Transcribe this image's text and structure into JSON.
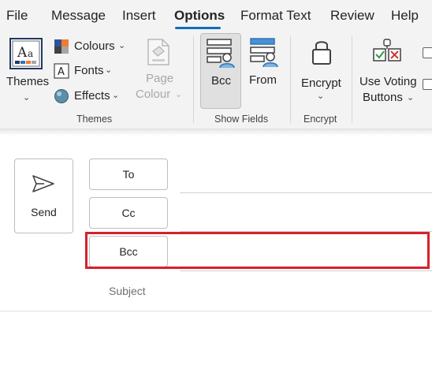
{
  "menu": {
    "items": [
      "File",
      "Message",
      "Insert",
      "Options",
      "Format Text",
      "Review",
      "Help"
    ],
    "active": "Options"
  },
  "ribbon": {
    "themes_group": {
      "themes_label": "Themes",
      "colours_label": "Colours",
      "fonts_label": "Fonts",
      "effects_label": "Effects",
      "page_label": "Page",
      "colour_label": "Colour",
      "group_label": "Themes"
    },
    "show_fields_group": {
      "bcc_label": "Bcc",
      "from_label": "From",
      "group_label": "Show Fields"
    },
    "encrypt_group": {
      "encrypt_label": "Encrypt",
      "group_label": "Encrypt"
    },
    "voting": {
      "line1": "Use Voting",
      "line2": "Buttons"
    }
  },
  "compose": {
    "send_label": "Send",
    "to_label": "To",
    "cc_label": "Cc",
    "bcc_label": "Bcc",
    "subject_label": "Subject"
  },
  "colors": {
    "accent": "#0f6cbd",
    "highlight": "#d6212b"
  }
}
